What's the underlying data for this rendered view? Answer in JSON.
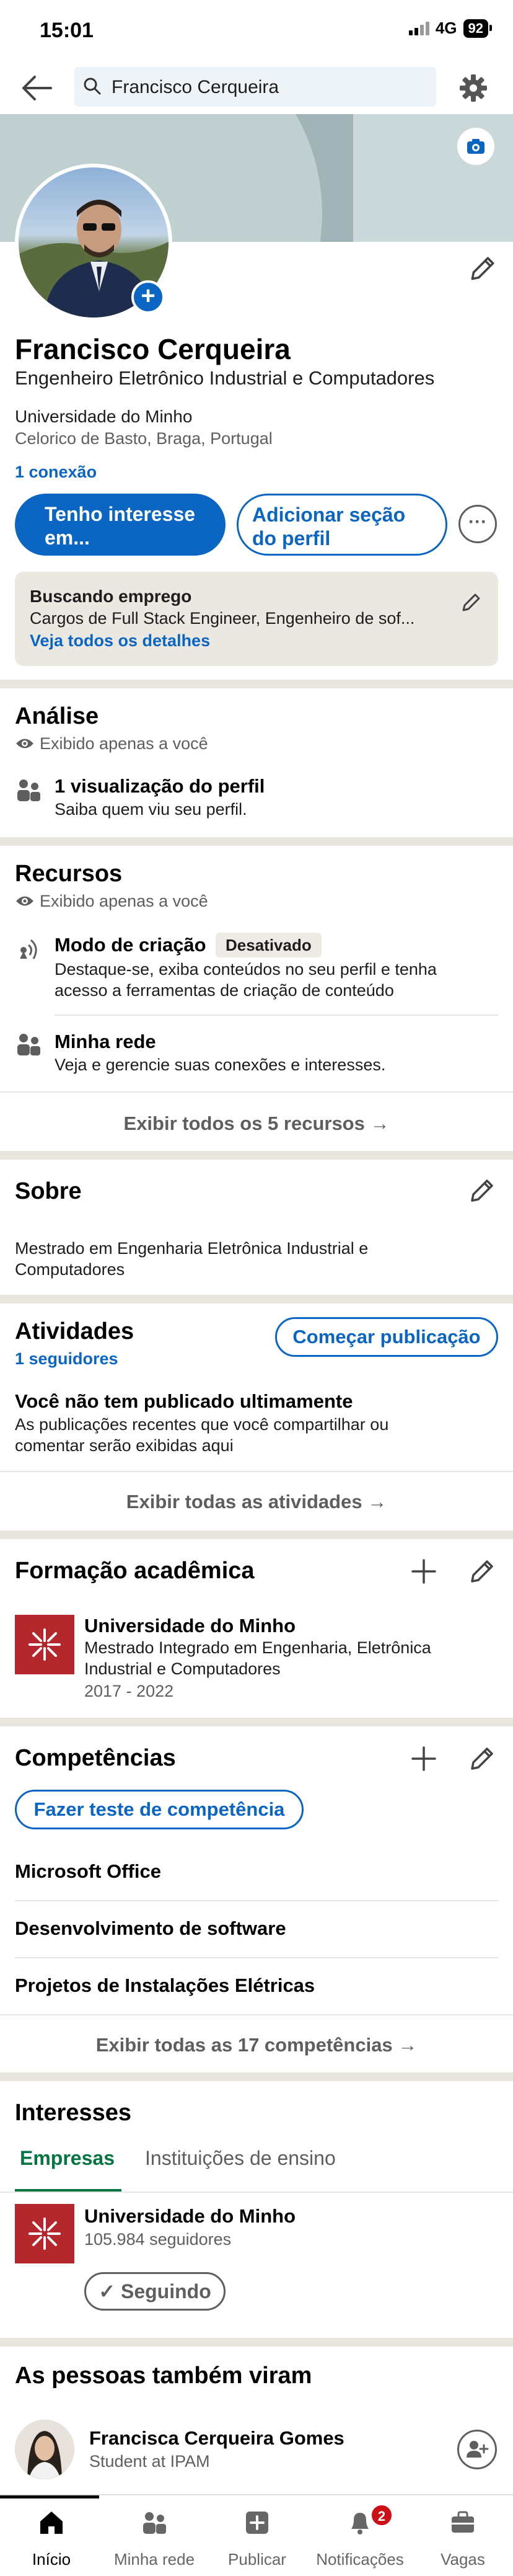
{
  "status_bar": {
    "time": "15:01",
    "network": "4G",
    "battery": "92"
  },
  "search": {
    "value": "Francisco Cerqueira"
  },
  "profile": {
    "name": "Francisco Cerqueira",
    "headline": "Engenheiro Eletrônico Industrial e Computadores",
    "school": "Universidade do Minho",
    "location": "Celorico de Basto, Braga, Portugal",
    "connections": "1 conexão",
    "btn_interest_line1": "Tenho interesse",
    "btn_interest_line2": "em...",
    "btn_add_line1": "Adicionar seção",
    "btn_add_line2": "do perfil",
    "more_label": "···"
  },
  "open_to_work": {
    "title": "Buscando emprego",
    "desc": "Cargos de Full Stack Engineer, Engenheiro de sof...",
    "link": "Veja todos os detalhes"
  },
  "analytics": {
    "title": "Análise",
    "private": "Exibido apenas a você",
    "item_title": "1 visualização do perfil",
    "item_sub": "Saiba quem viu seu perfil."
  },
  "resources": {
    "title": "Recursos",
    "private": "Exibido apenas a você",
    "creator_title": "Modo de criação",
    "creator_badge": "Desativado",
    "creator_desc1": "Destaque-se, exiba conteúdos no seu perfil e tenha",
    "creator_desc2": "acesso a ferramentas de criação de conteúdo",
    "network_title": "Minha rede",
    "network_desc": "Veja e gerencie suas conexões e interesses.",
    "show_all": "Exibir todos os 5 recursos →"
  },
  "about": {
    "title": "Sobre",
    "text1": "Mestrado em Engenharia Eletrônica Industrial e",
    "text2": "Computadores"
  },
  "activity": {
    "title": "Atividades",
    "followers": "1 seguidores",
    "start_post": "Começar publicação",
    "empty_title": "Você não tem publicado ultimamente",
    "empty_desc1": "As publicações recentes que você compartilhar ou",
    "empty_desc2": "comentar serão exibidas aqui",
    "show_all": "Exibir todas as atividades →"
  },
  "education": {
    "title": "Formação acadêmica",
    "school": "Universidade do Minho",
    "degree1": "Mestrado Integrado em Engenharia, Eletrônica",
    "degree2": "Industrial e Computadores",
    "years": "2017 - 2022"
  },
  "skills": {
    "title": "Competências",
    "test_btn": "Fazer teste de competência",
    "items": [
      "Microsoft Office",
      "Desenvolvimento de software",
      "Projetos de Instalações Elétricas"
    ],
    "show_all": "Exibir todas as 17 competências →"
  },
  "interests": {
    "title": "Interesses",
    "tabs": [
      "Empresas",
      "Instituições de ensino"
    ],
    "org_name": "Universidade do Minho",
    "org_followers": "105.984 seguidores",
    "following_label": "✓ Seguindo"
  },
  "people_also_viewed": {
    "title": "As pessoas também viram",
    "name": "Francisca Cerqueira Gomes",
    "subtitle": "Student at IPAM"
  },
  "bottom_nav": {
    "items": [
      "Início",
      "Minha rede",
      "Publicar",
      "Notificações",
      "Vagas"
    ],
    "notifications_badge": "2"
  },
  "colors": {
    "accent": "#0a66c2",
    "green": "#057642",
    "brand_red": "#b3272d"
  }
}
